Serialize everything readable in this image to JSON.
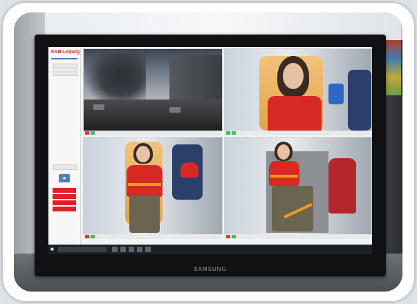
{
  "scene": {
    "description_free": true,
    "monitor_brand": "SAMSUNG"
  },
  "app": {
    "logo_text": "KSB-Leipzig",
    "accent_color": "#e01f26",
    "status_colors": {
      "ok": "#3cc25a",
      "alert": "#e03a3a"
    }
  },
  "camera_feeds": [
    {
      "id": "front"
    },
    {
      "id": "patient-face"
    },
    {
      "id": "cabin-left"
    },
    {
      "id": "cabin-right"
    }
  ],
  "icons": {
    "start": "windows-start-icon",
    "camera": "camera-icon"
  }
}
